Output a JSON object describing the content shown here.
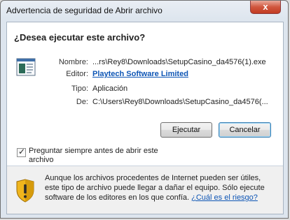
{
  "window": {
    "title": "Advertencia de seguridad de Abrir archivo",
    "close_glyph": "x"
  },
  "dialog": {
    "heading": "¿Desea ejecutar este archivo?",
    "fields": {
      "name_label": "Nombre:",
      "name_value": "...rs\\Rey8\\Downloads\\SetupCasino_da4576(1).exe",
      "publisher_label": "Editor:",
      "publisher_value": "Playtech Software Limited",
      "type_label": "Tipo:",
      "type_value": "Aplicación",
      "from_label": "De:",
      "from_value": "C:\\Users\\Rey8\\Downloads\\SetupCasino_da4576(..."
    },
    "buttons": {
      "run": "Ejecutar",
      "cancel": "Cancelar"
    },
    "checkbox": {
      "label": "Preguntar siempre antes de abrir este archivo",
      "checked": true
    },
    "warning": {
      "text": "Aunque los archivos procedentes de Internet pueden ser útiles, este tipo de archivo puede llegar a dañar el equipo. Sólo ejecute software de los editores en los que confía.",
      "link": "¿Cuál es el riesgo?"
    }
  },
  "icons": {
    "file": "application-file-icon",
    "warning": "security-shield-warning-icon"
  }
}
